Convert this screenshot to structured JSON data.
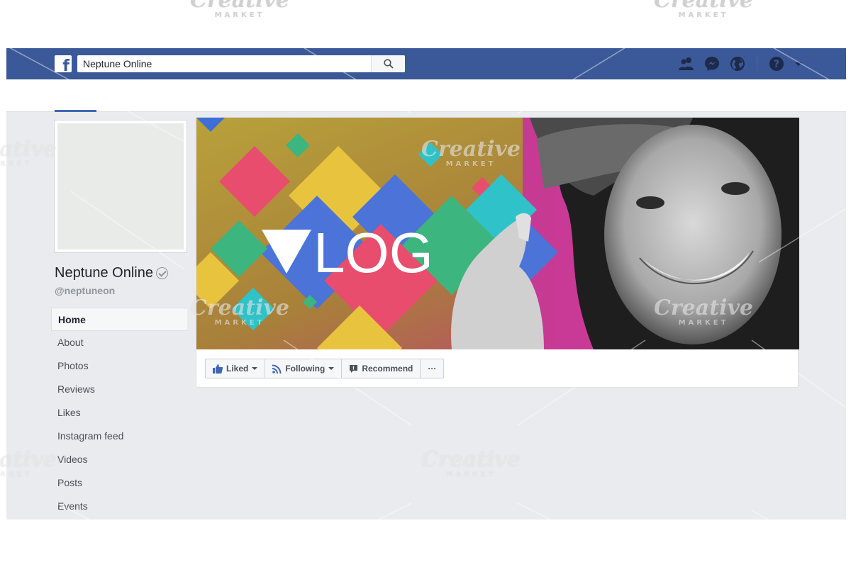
{
  "header": {
    "logo_letter": "f",
    "search": {
      "value": "Neptune Online",
      "placeholder": ""
    },
    "icons": [
      "friends-icon",
      "messenger-icon",
      "globe-icon",
      "help-icon"
    ]
  },
  "page": {
    "name": "Neptune Online",
    "handle": "@neptuneon"
  },
  "sidebar": {
    "items": [
      {
        "label": "Home",
        "active": true
      },
      {
        "label": "About"
      },
      {
        "label": "Photos"
      },
      {
        "label": "Reviews"
      },
      {
        "label": "Likes"
      },
      {
        "label": "Instagram feed"
      },
      {
        "label": "Videos"
      },
      {
        "label": "Posts"
      },
      {
        "label": "Events"
      }
    ]
  },
  "cover": {
    "title": "LOG"
  },
  "actions": {
    "liked": "Liked",
    "following": "Following",
    "recommend": "Recommend",
    "more": "···"
  },
  "watermark": {
    "brand": "Creative",
    "sub": "MARKET"
  },
  "colors": {
    "brand_blue": "#3b5998",
    "background": "#e9ebee",
    "accent": "#4267b2"
  }
}
